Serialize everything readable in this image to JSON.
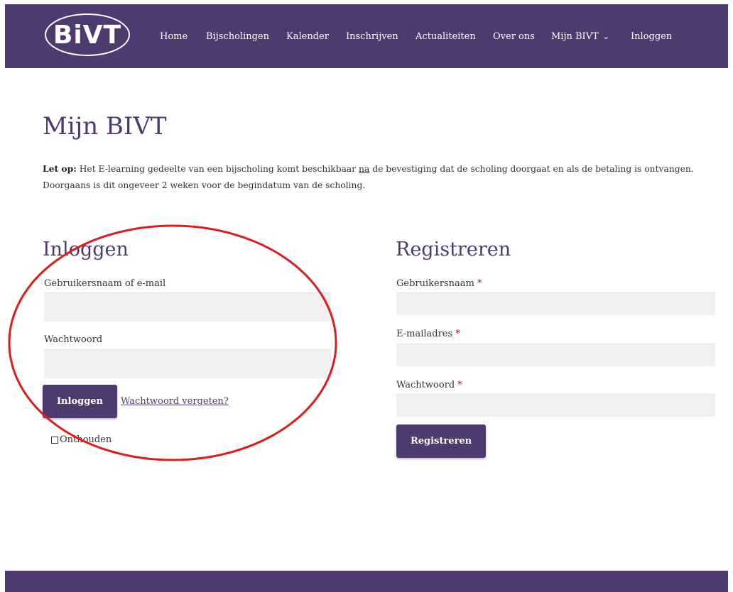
{
  "header": {
    "logo_text": "BiVT",
    "nav": [
      {
        "label": "Home"
      },
      {
        "label": "Bijscholingen"
      },
      {
        "label": "Kalender"
      },
      {
        "label": "Inschrijven"
      },
      {
        "label": "Actualiteiten"
      },
      {
        "label": "Over ons"
      },
      {
        "label": "Mijn BIVT",
        "has_dropdown": true,
        "chevron": "⌄"
      },
      {
        "label": "Inloggen"
      }
    ]
  },
  "page": {
    "title": "Mijn BIVT",
    "notice": {
      "bold": "Let op:",
      "part1": " Het E-learning gedeelte van een bijscholing komt beschikbaar ",
      "underlined": "na",
      "part2": " de bevestiging dat de scholing doorgaat en als de betaling is ontvangen. Doorgaans is dit ongeveer 2 weken voor de begindatum van de scholing."
    }
  },
  "login": {
    "heading": "Inloggen",
    "username_label": "Gebruikersnaam of e-mail",
    "username_value": "",
    "password_label": "Wachtwoord",
    "password_value": "",
    "submit_label": "Inloggen",
    "forgot_link": "Wachtwoord vergeten?",
    "remember_label": "Onthouden",
    "remember_checked": false
  },
  "register": {
    "heading": "Registreren",
    "username_label": "Gebruikersnaam",
    "email_label": "E-mailadres",
    "password_label": "Wachtwoord",
    "required_marker": "*",
    "submit_label": "Registreren"
  },
  "colors": {
    "brand_purple": "#4e3a6e",
    "field_bg": "#f1f1f1",
    "required_red": "#cc1111",
    "annotation_red": "#e01b1b"
  },
  "annotation": {
    "shape": "ellipse",
    "color": "#e01b1b",
    "encircles": "login-form"
  }
}
